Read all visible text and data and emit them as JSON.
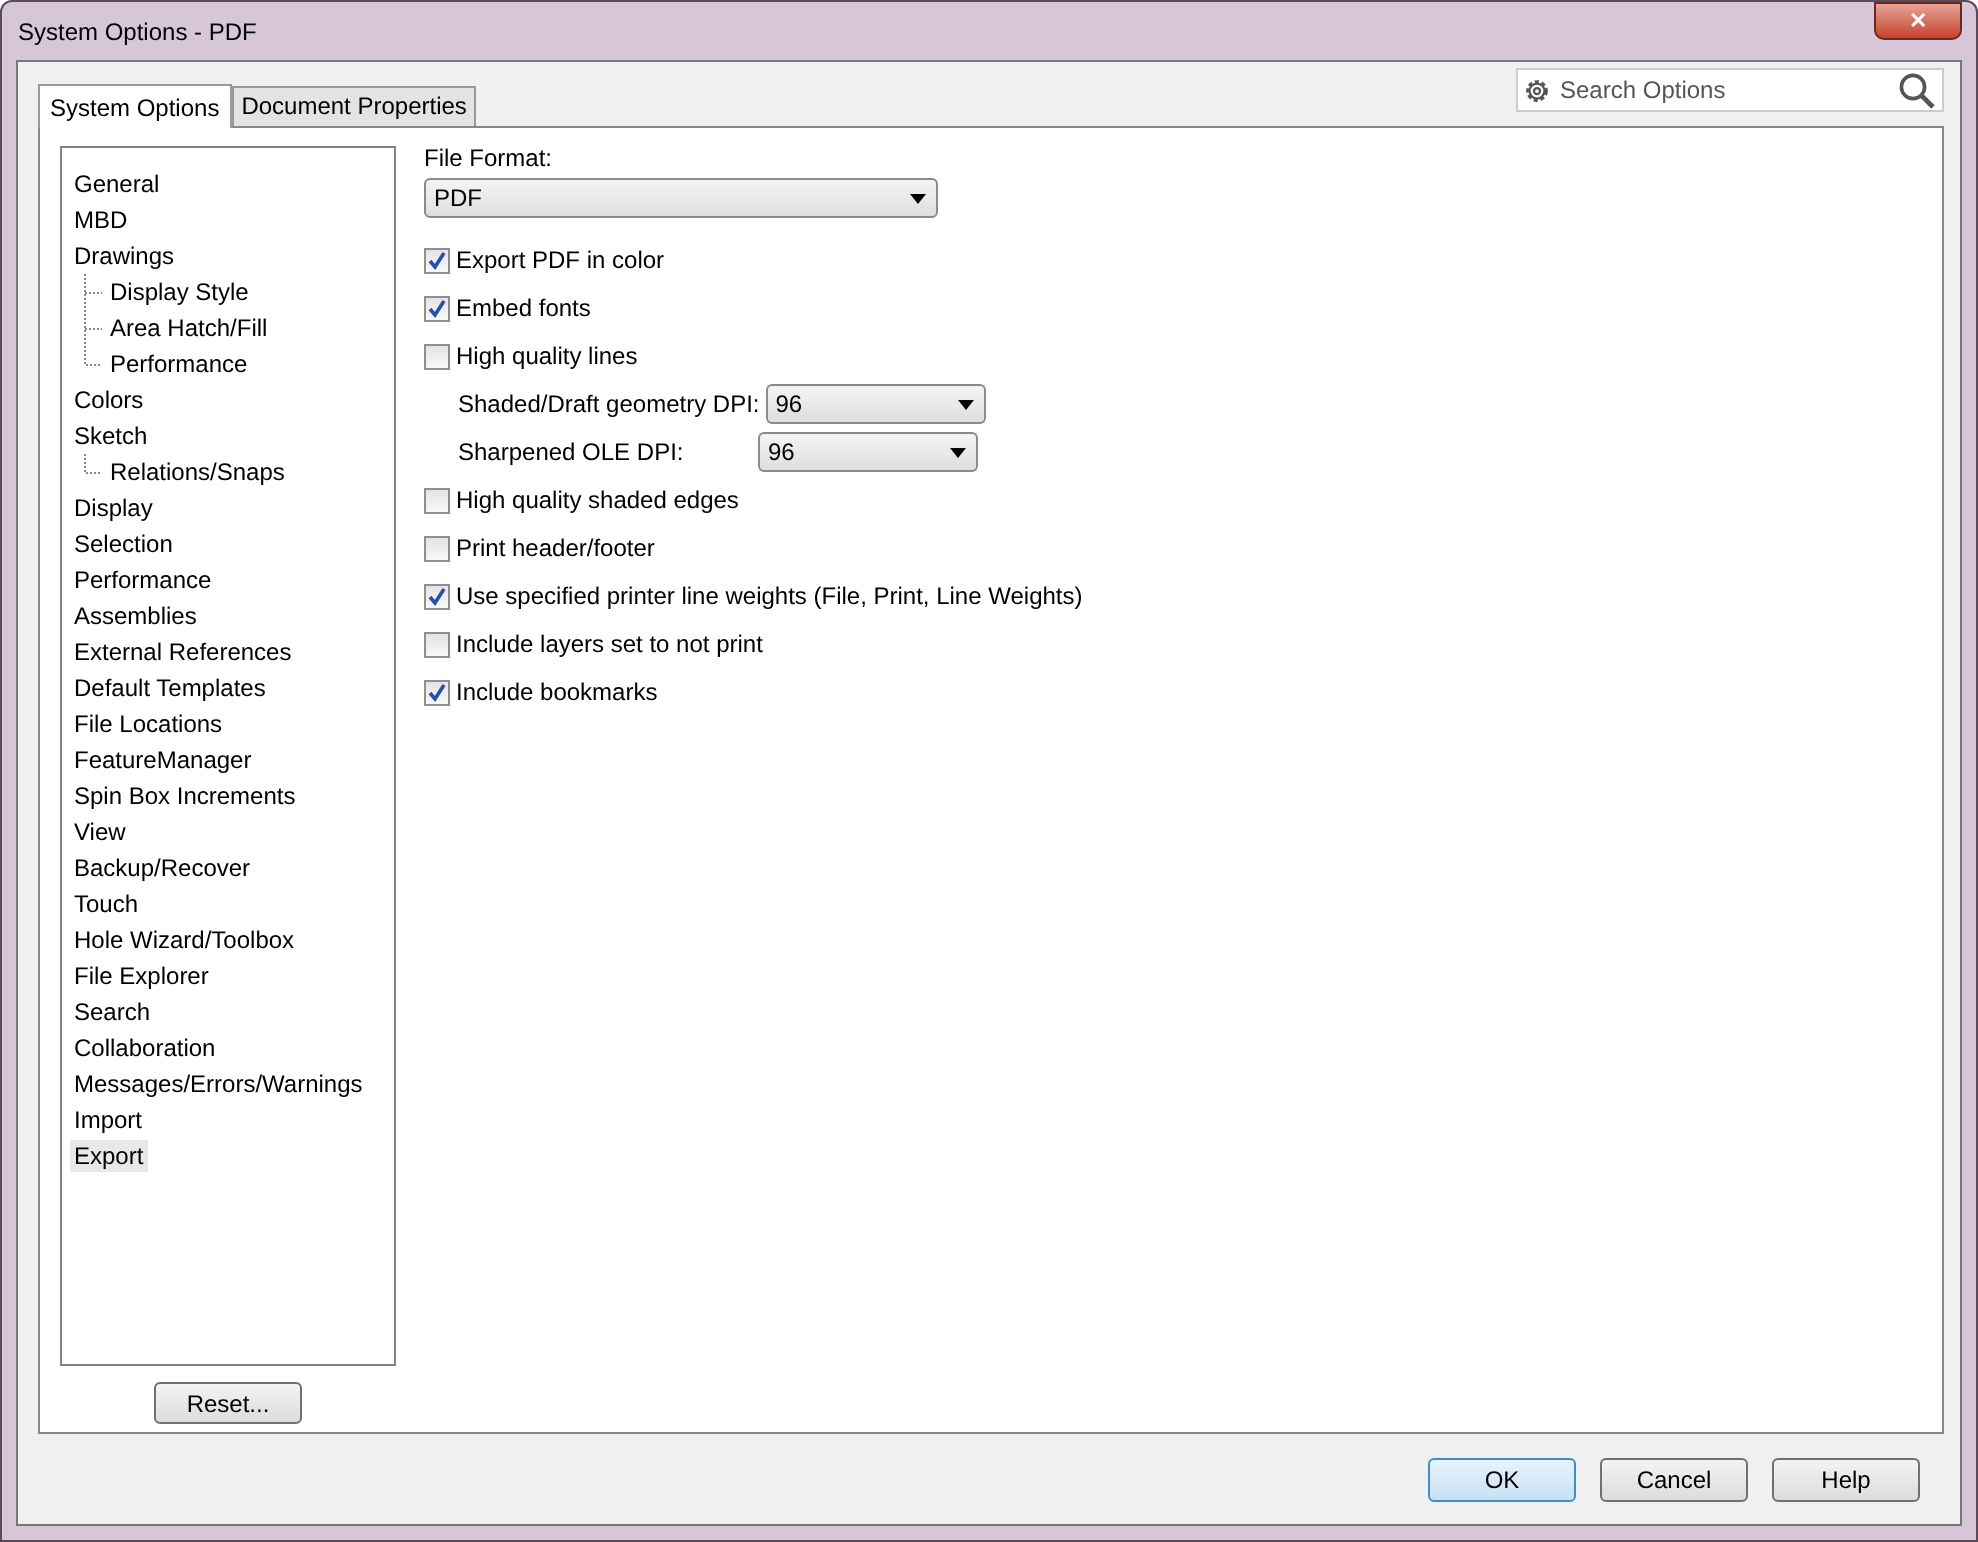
{
  "window": {
    "title": "System Options - PDF",
    "close": "✕"
  },
  "tabs": [
    {
      "label": "System Options",
      "selected": true
    },
    {
      "label": "Document Properties",
      "selected": false
    }
  ],
  "search": {
    "placeholder": "Search Options"
  },
  "sidebar": {
    "items": [
      {
        "label": "General",
        "selected": false
      },
      {
        "label": "MBD",
        "selected": false
      },
      {
        "label": "Drawings",
        "selected": false,
        "children": [
          {
            "label": "Display Style",
            "selected": false
          },
          {
            "label": "Area Hatch/Fill",
            "selected": false
          },
          {
            "label": "Performance",
            "selected": false
          }
        ]
      },
      {
        "label": "Colors",
        "selected": false
      },
      {
        "label": "Sketch",
        "selected": false,
        "children": [
          {
            "label": "Relations/Snaps",
            "selected": false
          }
        ]
      },
      {
        "label": "Display",
        "selected": false
      },
      {
        "label": "Selection",
        "selected": false
      },
      {
        "label": "Performance",
        "selected": false
      },
      {
        "label": "Assemblies",
        "selected": false
      },
      {
        "label": "External References",
        "selected": false
      },
      {
        "label": "Default Templates",
        "selected": false
      },
      {
        "label": "File Locations",
        "selected": false
      },
      {
        "label": "FeatureManager",
        "selected": false
      },
      {
        "label": "Spin Box Increments",
        "selected": false
      },
      {
        "label": "View",
        "selected": false
      },
      {
        "label": "Backup/Recover",
        "selected": false
      },
      {
        "label": "Touch",
        "selected": false
      },
      {
        "label": "Hole Wizard/Toolbox",
        "selected": false
      },
      {
        "label": "File Explorer",
        "selected": false
      },
      {
        "label": "Search",
        "selected": false
      },
      {
        "label": "Collaboration",
        "selected": false
      },
      {
        "label": "Messages/Errors/Warnings",
        "selected": false
      },
      {
        "label": "Import",
        "selected": false
      },
      {
        "label": "Export",
        "selected": true
      }
    ],
    "reset_button": "Reset..."
  },
  "file_format": {
    "label": "File Format:",
    "value": "PDF"
  },
  "options": [
    {
      "kind": "checkbox",
      "label": "Export PDF in color",
      "checked": true
    },
    {
      "kind": "checkbox",
      "label": "Embed fonts",
      "checked": true
    },
    {
      "kind": "checkbox",
      "label": "High quality lines",
      "checked": false
    },
    {
      "kind": "select",
      "label": "Shaded/Draft geometry DPI:",
      "value": "96"
    },
    {
      "kind": "select",
      "label": "Sharpened OLE DPI:",
      "value": "96"
    },
    {
      "kind": "checkbox",
      "label": "High quality shaded edges",
      "checked": false
    },
    {
      "kind": "checkbox",
      "label": "Print header/footer",
      "checked": false
    },
    {
      "kind": "checkbox",
      "label": "Use specified printer line weights (File, Print, Line Weights)",
      "checked": true
    },
    {
      "kind": "checkbox",
      "label": "Include layers set to not print",
      "checked": false
    },
    {
      "kind": "checkbox",
      "label": "Include bookmarks",
      "checked": true
    }
  ],
  "buttons": [
    {
      "label": "OK",
      "default": true
    },
    {
      "label": "Cancel",
      "default": false
    },
    {
      "label": "Help",
      "default": false
    }
  ]
}
